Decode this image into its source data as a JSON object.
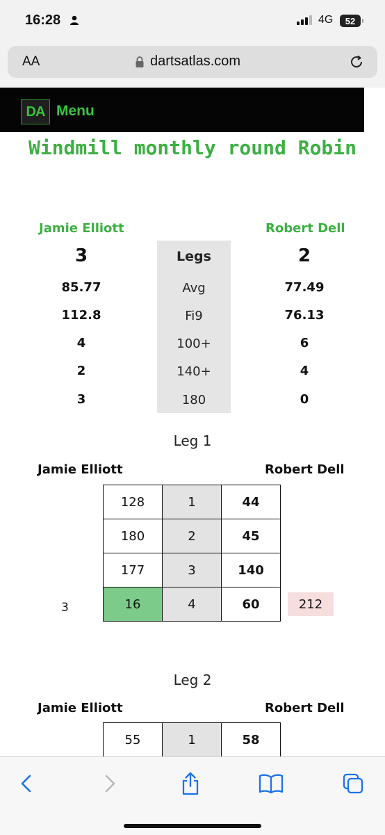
{
  "status_bar": {
    "time": "16:28",
    "network": "4G",
    "battery": "52"
  },
  "browser": {
    "text_size_label": "AA",
    "url": "dartsatlas.com"
  },
  "site": {
    "logo": "DA",
    "menu_label": "Menu",
    "title": "Windmill monthly round Robin"
  },
  "match": {
    "player1": "Jamie Elliott",
    "player2": "Robert Dell",
    "stats": [
      {
        "label": "Legs",
        "p1": "3",
        "p2": "2"
      },
      {
        "label": "Avg",
        "p1": "85.77",
        "p2": "77.49"
      },
      {
        "label": "Fi9",
        "p1": "112.8",
        "p2": "76.13"
      },
      {
        "label": "100+",
        "p1": "4",
        "p2": "6"
      },
      {
        "label": "140+",
        "p1": "2",
        "p2": "4"
      },
      {
        "label": "180",
        "p1": "3",
        "p2": "0"
      }
    ]
  },
  "legs": [
    {
      "title": "Leg 1",
      "player1": "Jamie Elliott",
      "player2": "Robert Dell",
      "rows": [
        {
          "p1": "128",
          "visit": "1",
          "p2": "44"
        },
        {
          "p1": "180",
          "visit": "2",
          "p2": "45"
        },
        {
          "p1": "177",
          "visit": "3",
          "p2": "140"
        },
        {
          "p1": "16",
          "visit": "4",
          "p2": "60"
        }
      ],
      "darts_last": "3",
      "p2_remaining": "212"
    },
    {
      "title": "Leg 2",
      "player1": "Jamie Elliott",
      "player2": "Robert Dell",
      "rows": [
        {
          "p1": "55",
          "visit": "1",
          "p2": "58"
        }
      ]
    }
  ],
  "colors": {
    "brand_green": "#3cb043",
    "win_cell": "#7dcb8a",
    "remaining_cell": "#f6dede"
  },
  "toolbar_icons": [
    "back-icon",
    "forward-icon",
    "share-icon",
    "bookmarks-icon",
    "tabs-icon"
  ]
}
